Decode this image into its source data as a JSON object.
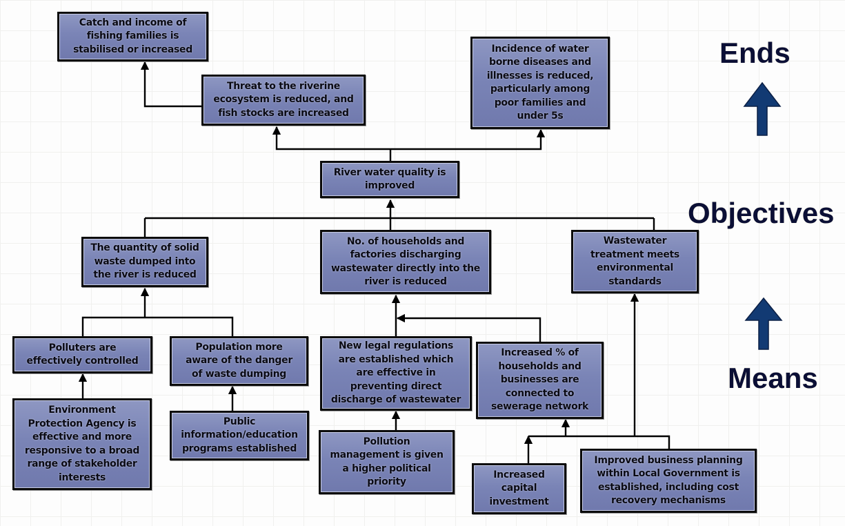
{
  "diagram": {
    "type": "objectives tree",
    "side_labels": {
      "ends": "Ends",
      "objectives": "Objectives",
      "means": "Means"
    },
    "colors": {
      "box_fill": "#7a84b6",
      "box_border": "#0b0b0b",
      "connector": "#000000",
      "side_label": "#0b0f35",
      "side_arrow": "#123a73"
    },
    "nodes": {
      "catch_income": "Catch and income of\nfishing families is\nstabilised or increased",
      "riverine_threat": "Threat to the riverine\necosystem is reduced, and\nfish stocks are increased",
      "water_diseases": "Incidence of water\nborne diseases and\nillnesses is reduced,\nparticularly among\npoor families and\nunder 5s",
      "river_quality": "River water quality is\nimproved",
      "solid_waste": "The quantity of solid\nwaste dumped into\nthe river is reduced",
      "households_discharging": "No. of households and\nfactories discharging\nwastewater directly into the\nriver is reduced",
      "wastewater_treatment": "Wastewater\ntreatment meets\nenvironmental\nstandards",
      "polluters_controlled": "Polluters are\neffectively controlled",
      "population_aware": "Population more\naware of the danger\nof waste dumping",
      "legal_regulations": "New legal regulations\nare established which\nare effective in\npreventing direct\ndischarge of wastewater",
      "sewerage_connected": "Increased % of\nhouseholds and\nbusinesses are\nconnected to\nsewerage network",
      "epa_effective": "Environment\nProtection Agency is\neffective and more\nresponsive to a broad\nrange of stakeholder\ninterests",
      "public_info": "Public\ninformation/education\nprograms established",
      "pollution_priority": "Pollution\nmanagement is given\na higher political\npriority",
      "capital_investment": "Increased\ncapital\ninvestment",
      "business_planning": "Improved business planning\nwithin Local Government is\nestablished, including cost\nrecovery mechanisms"
    },
    "edges": [
      {
        "from": "riverine_threat",
        "to": "catch_income"
      },
      {
        "from": "river_quality",
        "to": "riverine_threat"
      },
      {
        "from": "river_quality",
        "to": "water_diseases"
      },
      {
        "from": "solid_waste",
        "to": "river_quality"
      },
      {
        "from": "households_discharging",
        "to": "river_quality"
      },
      {
        "from": "wastewater_treatment",
        "to": "river_quality"
      },
      {
        "from": "polluters_controlled",
        "to": "solid_waste"
      },
      {
        "from": "population_aware",
        "to": "solid_waste"
      },
      {
        "from": "epa_effective",
        "to": "polluters_controlled"
      },
      {
        "from": "public_info",
        "to": "population_aware"
      },
      {
        "from": "legal_regulations",
        "to": "households_discharging"
      },
      {
        "from": "sewerage_connected",
        "to": "households_discharging"
      },
      {
        "from": "pollution_priority",
        "to": "legal_regulations"
      },
      {
        "from": "capital_investment",
        "to": "sewerage_connected"
      },
      {
        "from": "business_planning",
        "to": "sewerage_connected"
      },
      {
        "from": "business_planning",
        "to": "wastewater_treatment"
      }
    ]
  }
}
